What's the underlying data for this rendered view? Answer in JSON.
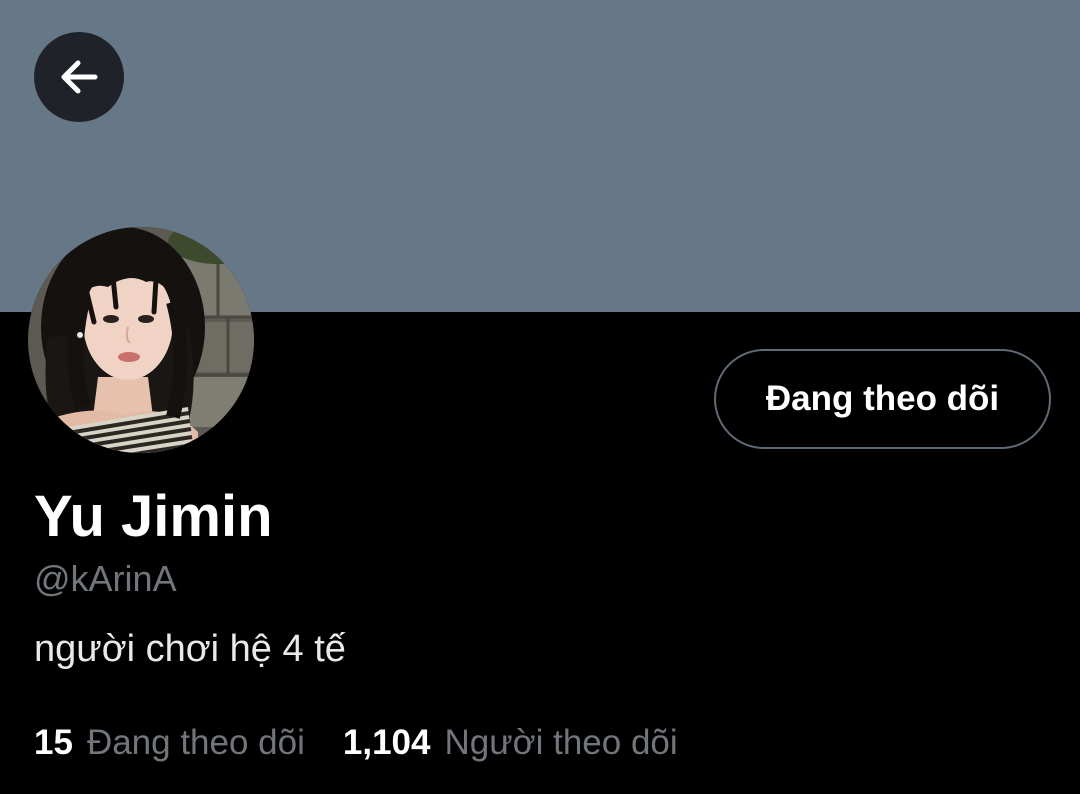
{
  "header": {
    "back_icon": "arrow-left-icon",
    "banner_color": "#667787"
  },
  "profile": {
    "display_name": "Yu Jimin",
    "handle": "@kArinA",
    "bio": "người chơi hệ 4 tế",
    "follow_button_label": "Đang theo dõi"
  },
  "stats": {
    "following_count": "15",
    "following_label": "Đang theo dõi",
    "followers_count": "1,104",
    "followers_label": "Người theo dõi"
  },
  "colors": {
    "background": "#000000",
    "primary_text": "#ffffff",
    "secondary_text": "#71767b",
    "button_border": "#5f6a74"
  }
}
